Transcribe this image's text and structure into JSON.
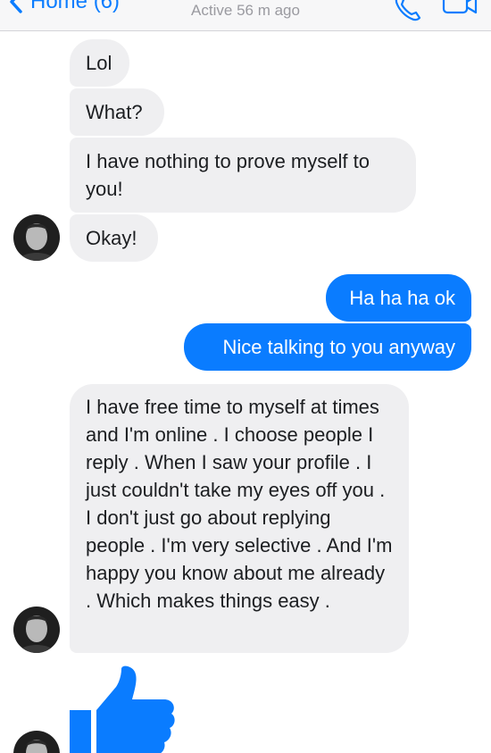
{
  "header": {
    "back_label": "Home (6)",
    "status": "Active 56 m ago"
  },
  "messages": [
    {
      "side": "in",
      "text": "Lol"
    },
    {
      "side": "in",
      "text": "What?"
    },
    {
      "side": "in",
      "text": "I have nothing to prove myself to you!"
    },
    {
      "side": "in",
      "text": "Okay!"
    },
    {
      "side": "out",
      "text": "Ha ha ha ok"
    },
    {
      "side": "out",
      "text": "Nice talking to you anyway"
    },
    {
      "side": "in",
      "text": "I have free time to myself at times and I'm online . I choose people I reply . When I saw your profile . I just couldn't take my eyes off you . I don't just go about replying people . I'm very selective . And I'm happy you know about me already . Which makes things easy ."
    },
    {
      "side": "in",
      "text": "thumbs-up-icon"
    }
  ],
  "colors": {
    "accent": "#0a7cff",
    "incoming_bubble": "#efeff1",
    "header_bg": "#f7f7f8"
  },
  "icons": [
    "back-chevron-icon",
    "phone-icon",
    "video-camera-icon",
    "thumbs-up-icon"
  ]
}
